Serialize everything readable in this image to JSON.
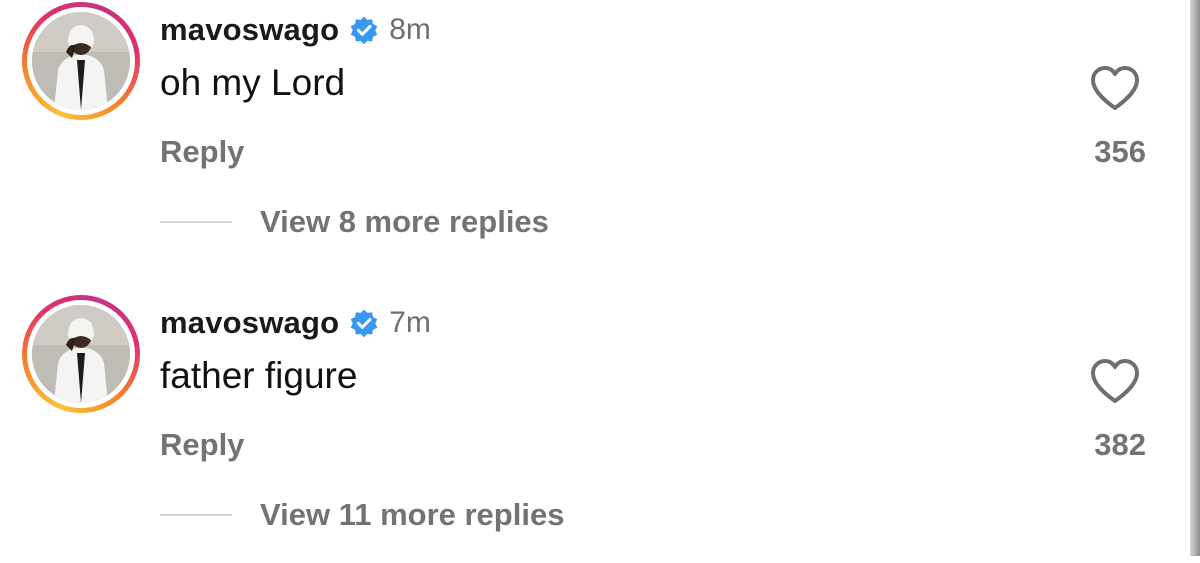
{
  "comments": [
    {
      "username": "mavoswago",
      "verified": true,
      "time": "8m",
      "text": "oh my Lord",
      "reply_label": "Reply",
      "likes": "356",
      "view_replies": "View 8 more replies"
    },
    {
      "username": "mavoswago",
      "verified": true,
      "time": "7m",
      "text": "father figure",
      "reply_label": "Reply",
      "likes": "382",
      "view_replies": "View 11 more replies"
    }
  ],
  "icons": {
    "verified": "verified-badge-icon",
    "like": "heart-outline-icon"
  },
  "colors": {
    "verified_blue": "#3897f0",
    "secondary_text": "#737373",
    "story_ring": [
      "#f9c33a",
      "#f58529",
      "#e1306c",
      "#c13584"
    ]
  }
}
